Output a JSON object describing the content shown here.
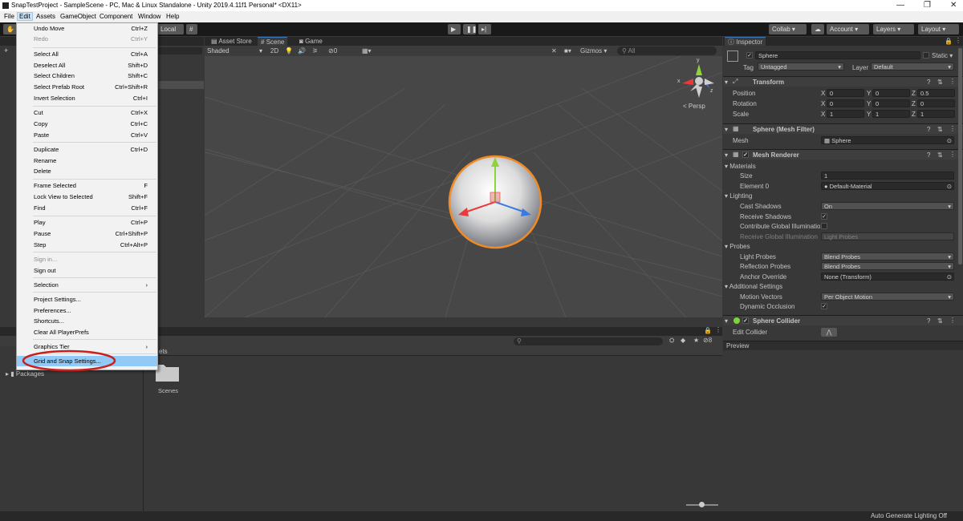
{
  "window": {
    "title": "SnapTestProject - SampleScene - PC, Mac & Linux Standalone - Unity 2019.4.11f1 Personal* <DX11>",
    "minimize": "—",
    "maximize": "❐",
    "close": "✕"
  },
  "menubar": [
    "File",
    "Edit",
    "Assets",
    "GameObject",
    "Component",
    "Window",
    "Help"
  ],
  "toolbar": {
    "local": "Local",
    "collab": "Collab ▾",
    "account": "Account",
    "layers": "Layers",
    "layout": "Layout"
  },
  "edit_menu": [
    {
      "label": "Undo Move",
      "shortcut": "Ctrl+Z"
    },
    {
      "label": "Redo",
      "shortcut": "Ctrl+Y",
      "disabled": true
    },
    {
      "label": "Select All",
      "shortcut": "Ctrl+A"
    },
    {
      "label": "Deselect All",
      "shortcut": "Shift+D"
    },
    {
      "label": "Select Children",
      "shortcut": "Shift+C"
    },
    {
      "label": "Select Prefab Root",
      "shortcut": "Ctrl+Shift+R"
    },
    {
      "label": "Invert Selection",
      "shortcut": "Ctrl+I"
    },
    {
      "label": "Cut",
      "shortcut": "Ctrl+X"
    },
    {
      "label": "Copy",
      "shortcut": "Ctrl+C"
    },
    {
      "label": "Paste",
      "shortcut": "Ctrl+V"
    },
    {
      "label": "Duplicate",
      "shortcut": "Ctrl+D"
    },
    {
      "label": "Rename",
      "shortcut": ""
    },
    {
      "label": "Delete",
      "shortcut": ""
    },
    {
      "label": "Frame Selected",
      "shortcut": "F"
    },
    {
      "label": "Lock View to Selected",
      "shortcut": "Shift+F"
    },
    {
      "label": "Find",
      "shortcut": "Ctrl+F"
    },
    {
      "label": "Play",
      "shortcut": "Ctrl+P"
    },
    {
      "label": "Pause",
      "shortcut": "Ctrl+Shift+P"
    },
    {
      "label": "Step",
      "shortcut": "Ctrl+Alt+P"
    },
    {
      "label": "Sign in...",
      "shortcut": "",
      "disabled": true
    },
    {
      "label": "Sign out",
      "shortcut": ""
    },
    {
      "label": "Selection",
      "shortcut": "›"
    },
    {
      "label": "Project Settings...",
      "shortcut": ""
    },
    {
      "label": "Preferences...",
      "shortcut": ""
    },
    {
      "label": "Shortcuts...",
      "shortcut": ""
    },
    {
      "label": "Clear All PlayerPrefs",
      "shortcut": ""
    },
    {
      "label": "Graphics Tier",
      "shortcut": "›"
    },
    {
      "label": "Grid and Snap Settings...",
      "shortcut": "",
      "highlighted": true
    }
  ],
  "tabs": {
    "asset_store": "Asset Store",
    "scene": "Scene",
    "game": "Game",
    "inspector": "Inspector",
    "preview": "Preview"
  },
  "scene_toolbar": {
    "shading": "Shaded",
    "mode2d": "2D",
    "fx": "0",
    "gizmos": "Gizmos",
    "search": "All",
    "persp": "< Persp"
  },
  "gizmo_axes": {
    "x": "x",
    "y": "y",
    "z": "z"
  },
  "inspector": {
    "object_name": "Sphere",
    "static": "Static",
    "tag_label": "Tag",
    "tag": "Untagged",
    "layer_label": "Layer",
    "layer": "Default",
    "transform": {
      "title": "Transform",
      "rows": [
        {
          "label": "Position",
          "x": "0",
          "y": "0",
          "z": "0.5"
        },
        {
          "label": "Rotation",
          "x": "0",
          "y": "0",
          "z": "0"
        },
        {
          "label": "Scale",
          "x": "1",
          "y": "1",
          "z": "1"
        }
      ]
    },
    "mesh_filter": {
      "title": "Sphere (Mesh Filter)",
      "mesh_label": "Mesh",
      "mesh": "Sphere"
    },
    "mesh_renderer": {
      "title": "Mesh Renderer",
      "materials": "Materials",
      "size_label": "Size",
      "size": "1",
      "element0_label": "Element 0",
      "element0": "Default-Material",
      "lighting": "Lighting",
      "cast_shadows_label": "Cast Shadows",
      "cast_shadows": "On",
      "receive_shadows_label": "Receive Shadows",
      "contrib_gi_label": "Contribute Global Illumination",
      "receive_gi_label": "Receive Global Illumination",
      "receive_gi": "Light Probes",
      "probes": "Probes",
      "light_probes_label": "Light Probes",
      "light_probes": "Blend Probes",
      "reflection_probes_label": "Reflection Probes",
      "reflection_probes": "Blend Probes",
      "anchor_label": "Anchor Override",
      "anchor": "None (Transform)",
      "additional": "Additional Settings",
      "motion_label": "Motion Vectors",
      "motion": "Per Object Motion",
      "dyn_occ_label": "Dynamic Occlusion"
    },
    "sphere_collider": {
      "title": "Sphere Collider",
      "edit_label": "Edit Collider"
    }
  },
  "project": {
    "assets_tab": "ets",
    "folder": "Scenes",
    "packages": "Packages",
    "count": "8"
  },
  "status": {
    "right": "Auto Generate Lighting Off"
  },
  "colors": {
    "highlight_ring": "#c8201e",
    "selection_outline": "#f08a24",
    "menu_highlight": "#91c9f7"
  }
}
